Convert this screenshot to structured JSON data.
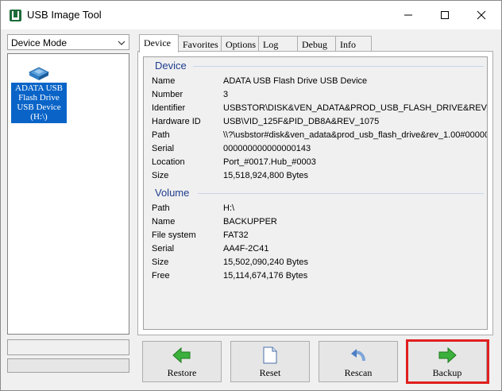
{
  "window": {
    "title": "USB Image Tool",
    "icons": {
      "app": "usb-image-tool-app-icon",
      "minimize": "minimize-icon",
      "maximize": "maximize-icon",
      "close": "close-icon"
    }
  },
  "sidebar": {
    "mode_select": {
      "value": "Device Mode",
      "icon": "chevron-down-icon"
    },
    "device": {
      "label_lines": [
        "ADATA USB",
        "Flash Drive",
        "USB Device",
        "(H:\\)"
      ],
      "icon": "usb-drive-icon",
      "selected": true
    },
    "selection_color": "#0a64c8"
  },
  "tabs": [
    {
      "label": "Device",
      "active": true
    },
    {
      "label": "Favorites",
      "active": false
    },
    {
      "label": "Options",
      "active": false
    },
    {
      "label": "Log",
      "active": false
    },
    {
      "label": "Debug",
      "active": false
    },
    {
      "label": "Info",
      "active": false
    }
  ],
  "device_group": {
    "title": "Device",
    "rows": [
      {
        "label": "Name",
        "value": "ADATA USB Flash Drive USB Device"
      },
      {
        "label": "Number",
        "value": "3"
      },
      {
        "label": "Identifier",
        "value": "USBSTOR\\DISK&VEN_ADATA&PROD_USB_FLASH_DRIVE&REV_"
      },
      {
        "label": "Hardware ID",
        "value": "USB\\VID_125F&PID_DB8A&REV_1075"
      },
      {
        "label": "Path",
        "value": "\\\\?\\usbstor#disk&ven_adata&prod_usb_flash_drive&rev_1.00#00000"
      },
      {
        "label": "Serial",
        "value": "000000000000000143"
      },
      {
        "label": "Location",
        "value": "Port_#0017.Hub_#0003"
      },
      {
        "label": "Size",
        "value": "15,518,924,800 Bytes"
      }
    ]
  },
  "volume_group": {
    "title": "Volume",
    "rows": [
      {
        "label": "Path",
        "value": "H:\\"
      },
      {
        "label": "Name",
        "value": "BACKUPPER"
      },
      {
        "label": "File system",
        "value": "FAT32"
      },
      {
        "label": "Serial",
        "value": "AA4F-2C41"
      },
      {
        "label": "Size",
        "value": "15,502,090,240 Bytes"
      },
      {
        "label": "Free",
        "value": "15,114,674,176 Bytes"
      }
    ]
  },
  "buttons": {
    "restore": {
      "label": "Restore",
      "icon": "arrow-left-icon"
    },
    "reset": {
      "label": "Reset",
      "icon": "document-icon"
    },
    "rescan": {
      "label": "Rescan",
      "icon": "rescan-arrow-icon"
    },
    "backup": {
      "label": "Backup",
      "icon": "arrow-right-icon",
      "highlighted": true
    }
  },
  "colors": {
    "group_title": "#1f3d8f",
    "highlight_border": "#e0201f",
    "arrow_green": "#3cb03c"
  }
}
